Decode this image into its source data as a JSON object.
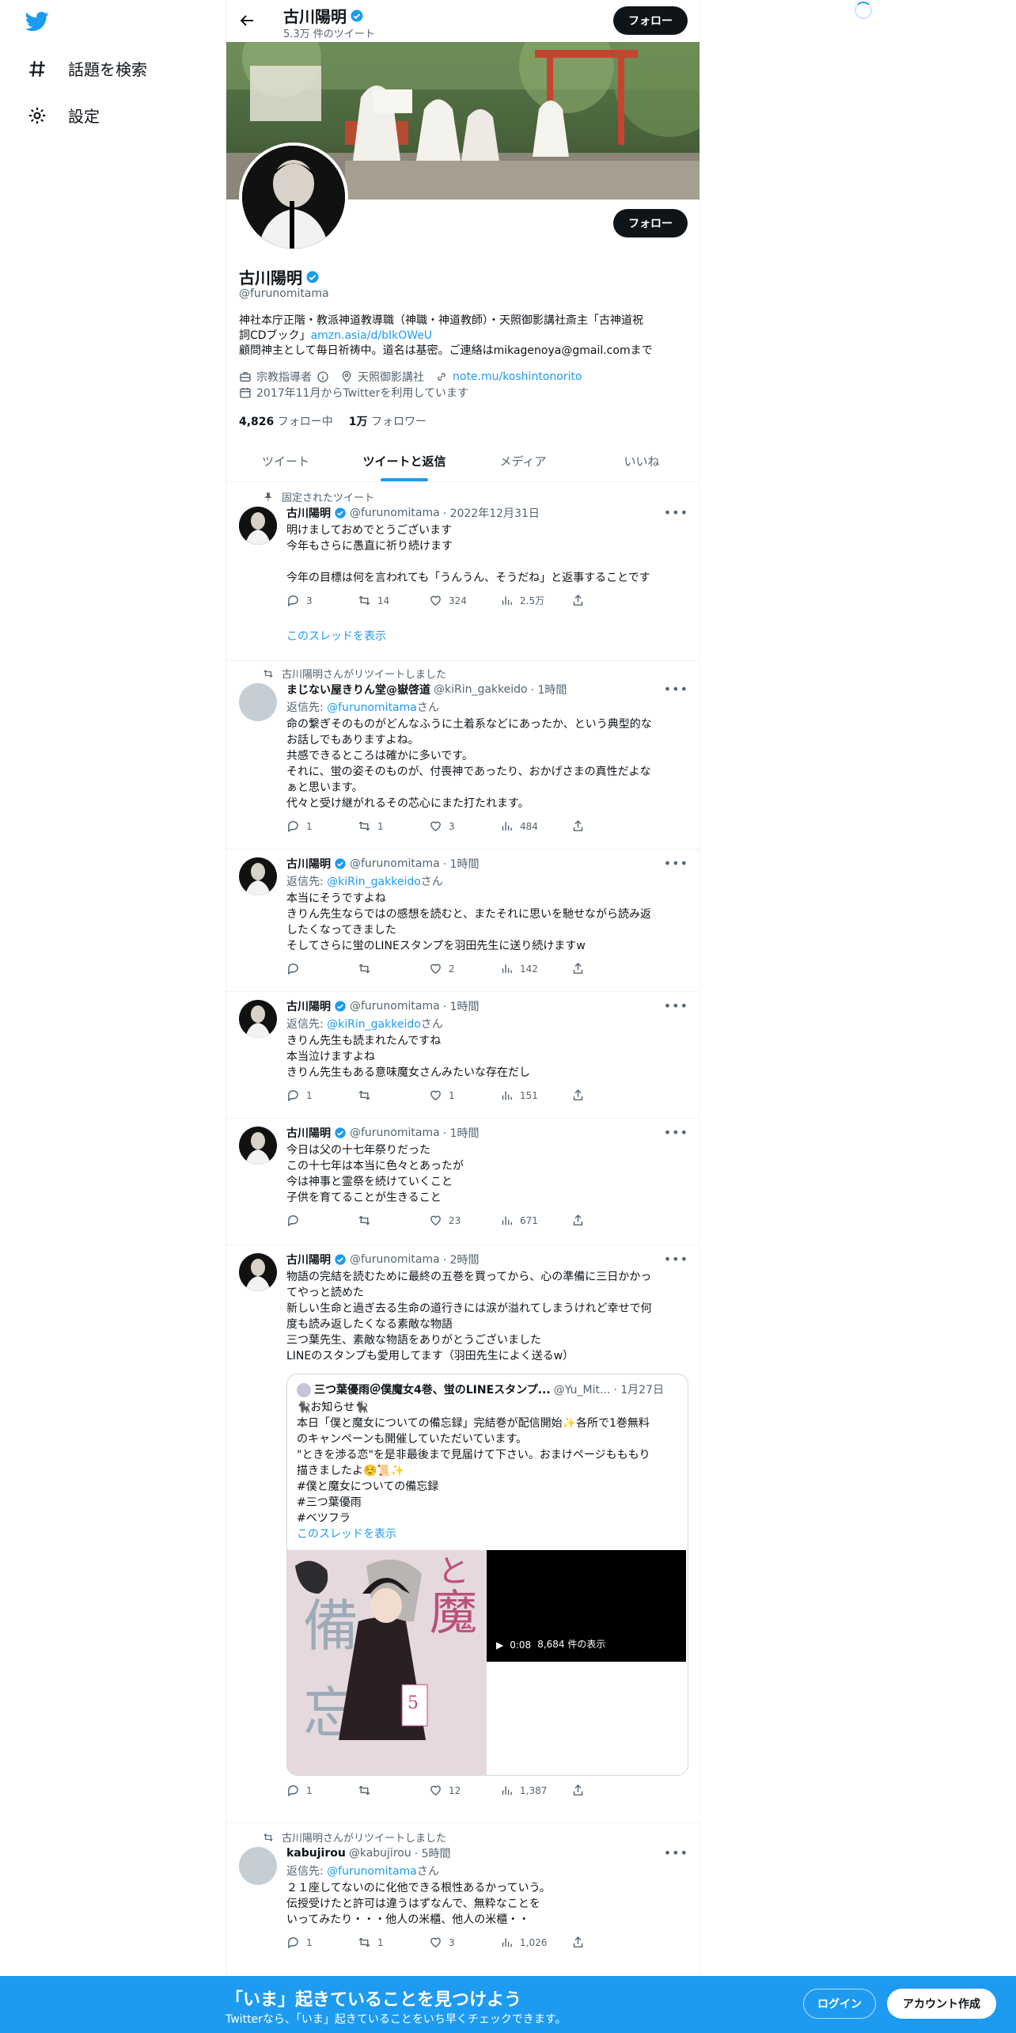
{
  "nav": {
    "explore_label": "話題を検索",
    "settings_label": "設定"
  },
  "header": {
    "name": "古川陽明",
    "tweet_count": "5.3万 件のツイート",
    "follow_label": "フォロー"
  },
  "profile": {
    "name": "古川陽明",
    "handle": "@furunomitama",
    "follow_label": "フォロー",
    "bio_line1": "神社本庁正階・教派神道教導職（神職・神道教師）・天照御影講社斎主「古神道祝",
    "bio_line2_pre": "詞CDブック」",
    "bio_link": "amzn.asia/d/bIkOWeU",
    "bio_line3": "顧問神主として毎日祈祷中。道名は基密。ご連絡はmikagenoya@gmail.comまで",
    "category": "宗教指導者",
    "location": "天照御影講社",
    "url": "note.mu/koshintonorito",
    "joined": "2017年11月からTwitterを利用しています",
    "following_count": "4,826",
    "following_label": "フォロー中",
    "followers_count": "1万",
    "followers_label": "フォロワー"
  },
  "tabs": [
    {
      "label": "ツイート"
    },
    {
      "label": "ツイートと返信"
    },
    {
      "label": "メディア"
    },
    {
      "label": "いいね"
    }
  ],
  "tweets": [
    {
      "social": "固定されたツイート",
      "name": "古川陽明",
      "handle": "@furunomitama",
      "time": "· 2022年12月31日",
      "text": "明けましておめでとうございます\n今年もさらに愚直に祈り続けます\n\n今年の目標は何を言われても「うんうん、そうだね」と返事することです",
      "reply": "3",
      "retweet": "14",
      "like": "324",
      "views": "2.5万",
      "show_thread": "このスレッドを表示"
    },
    {
      "social": "古川陽明さんがリツイートしました",
      "name": "まじない屋きりん堂@嶽啓道",
      "handle": "@kiRin_gakkeido",
      "time": "· 1時間",
      "reply_pre": "返信先: ",
      "reply_to": "@furunomitama",
      "reply_post": "さん",
      "text": "命の繋ぎそのものがどんなふうに土着系などにあったか、という典型的な\nお話しでもありますよね。\n共感できるところは確かに多いです。\nそれに、蛍の姿そのものが、付喪神であったり、おかげさまの真性だよな\nぁと思います。\n代々と受け継がれるその芯心にまた打たれます。",
      "reply": "1",
      "retweet": "1",
      "like": "3",
      "views": "484"
    },
    {
      "name": "古川陽明",
      "handle": "@furunomitama",
      "time": "· 1時間",
      "reply_pre": "返信先: ",
      "reply_to": "@kiRin_gakkeido",
      "reply_post": "さん",
      "text": "本当にそうですよね\nきりん先生ならではの感想を読むと、またそれに思いを馳せながら読み返\nしたくなってきました\nそしてさらに蛍のLINEスタンプを羽田先生に送り続けますw",
      "reply": "",
      "retweet": "",
      "like": "2",
      "views": "142"
    },
    {
      "name": "古川陽明",
      "handle": "@furunomitama",
      "time": "· 1時間",
      "reply_pre": "返信先: ",
      "reply_to": "@kiRin_gakkeido",
      "reply_post": "さん",
      "text": "きりん先生も読まれたんですね\n本当泣けますよね\nきりん先生もある意味魔女さんみたいな存在だし",
      "reply": "1",
      "retweet": "",
      "like": "1",
      "views": "151"
    },
    {
      "name": "古川陽明",
      "handle": "@furunomitama",
      "time": "· 1時間",
      "text": "今日は父の十七年祭りだった\nこの十七年は本当に色々とあったが\n今は神事と霊祭を続けていくこと\n子供を育てることが生きること",
      "reply": "",
      "retweet": "",
      "like": "23",
      "views": "671"
    },
    {
      "name": "古川陽明",
      "handle": "@furunomitama",
      "time": "· 2時間",
      "text": "物語の完結を読むために最終の五巻を買ってから、心の準備に三日かかっ\nてやっと読めた\n新しい生命と過ぎ去る生命の道行きには涙が溢れてしまうけれど幸せで何\n度も読み返したくなる素敵な物語\n三つ葉先生、素敵な物語をありがとうございました\nLINEのスタンプも愛用してます（羽田先生によく送るw）",
      "quote": {
        "name": "三つ葉優雨＠僕魔女4巻、蛍のLINEスタンプ...",
        "handle": "@Yu_Mit...",
        "time": "· 1月27日",
        "text": "🐈‍⬛お知らせ🐈‍⬛\n本日「僕と魔女についての備忘録」完結巻が配信開始✨各所で1巻無料\nのキャンペーンも開催していただいています。\n\"ときを渉る恋\"を是非最後まで見届けて下さい。おまけページもももり\n描きましたよ☺️📜✨\n#僕と魔女についての備忘録\n#三つ葉優雨\n#ベツフラ",
        "show_thread": "このスレッドを表示",
        "video_time": "0:08",
        "video_views": "8,684 件の表示"
      },
      "reply": "1",
      "retweet": "",
      "like": "12",
      "views": "1,387"
    },
    {
      "social": "古川陽明さんがリツイートしました",
      "name": "kabujirou",
      "handle": "@kabujirou",
      "time": "· 5時間",
      "reply_pre": "返信先: ",
      "reply_to": "@furunomitama",
      "reply_post": "さん",
      "text": "２１座してないのに化他できる根性あるかっていう。\n伝授受けたと許可は違うはずなんで、無粋なことを\nいってみたり・・・他人の米櫃、他人の米櫃・・",
      "reply": "1",
      "retweet": "1",
      "like": "3",
      "views": "1,026"
    }
  ],
  "bottom": {
    "title": "「いま」起きていることを見つけよう",
    "subtitle": "Twitterなら、「いま」起きていることをいち早くチェックできます。",
    "login_label": "ログイン",
    "signup_label": "アカウント作成"
  },
  "colors": {
    "accent": "#1d9bf0",
    "text": "#0f1419",
    "muted": "#536471"
  }
}
